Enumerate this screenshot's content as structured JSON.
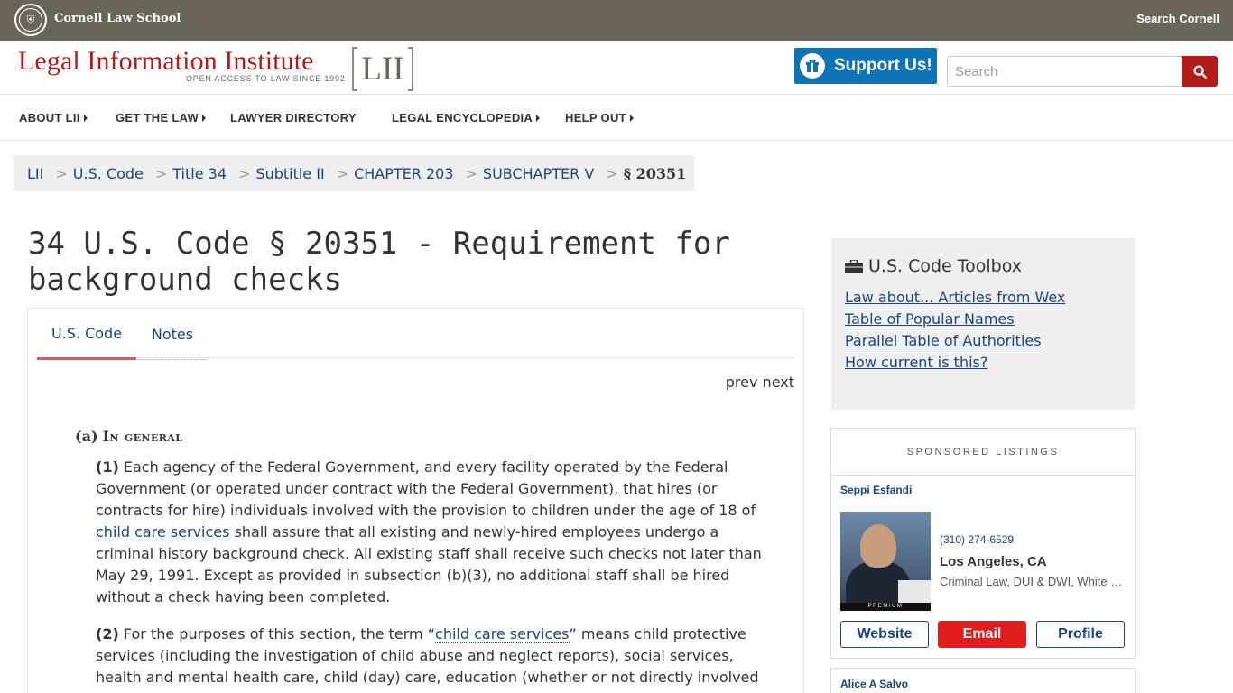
{
  "cornell": {
    "name": "Cornell Law School",
    "search_link": "Search Cornell"
  },
  "logo": {
    "title": "Legal Information Institute",
    "tagline": "OPEN ACCESS TO LAW SINCE 1992",
    "mark": "LII"
  },
  "header": {
    "support_label": "Support Us!",
    "search_placeholder": "Search"
  },
  "nav": {
    "items": [
      {
        "label": "ABOUT LII"
      },
      {
        "label": "GET THE LAW"
      },
      {
        "label": "LAWYER DIRECTORY"
      },
      {
        "label": "LEGAL ENCYCLOPEDIA"
      },
      {
        "label": "HELP OUT"
      }
    ]
  },
  "breadcrumb": {
    "items": [
      "LII",
      "U.S. Code",
      "Title 34",
      "Subtitle II",
      "CHAPTER 203",
      "SUBCHAPTER V"
    ],
    "separator": ">",
    "current": "§ 20351"
  },
  "page": {
    "title": "34 U.S. Code § 20351 - Requirement for background checks"
  },
  "tabs": {
    "code": "U.S. Code",
    "notes": "Notes"
  },
  "pager": {
    "prev": "prev",
    "next": "next"
  },
  "statute": {
    "section_a": {
      "label": "(a)",
      "heading": "In general"
    },
    "p1": {
      "num": "(1)",
      "text_before": " Each agency of the Federal Government, and every facility operated by the Federal Government (or operated under contract with the Federal Government), that hires (or contracts for hire) individuals involved with the provision to children under the age of 18 of ",
      "term": "child care services",
      "text_after": " shall assure that all existing and newly-hired employees undergo a criminal history background check. All existing staff shall receive such checks not later than May 29, 1991. Except as provided in subsection (b)(3), no additional staff shall be hired without a check having been completed."
    },
    "p2": {
      "num": "(2)",
      "text_before": " For the purposes of this section, the term “",
      "term": "child care services",
      "text_after": "” means child protective services (including the investigation of child abuse and neglect reports), social services, health and mental health care, child (day) care, education (whether or not directly involved"
    }
  },
  "toolbox": {
    "title": "U.S. Code Toolbox",
    "links": [
      "Law about... Articles from Wex",
      "Table of Popular Names",
      "Parallel Table of Authorities",
      "How current is this?"
    ]
  },
  "sponsored": {
    "heading": "SPONSORED LISTINGS",
    "listing1": {
      "name": "Seppi Esfandi",
      "badge": "PREMIUM",
      "phone": "(310) 274-6529",
      "location": "Los Angeles, CA",
      "practice": "Criminal Law, DUI & DWI, White Collar Crime",
      "website": "Website",
      "email": "Email",
      "profile": "Profile"
    },
    "listing2": {
      "name": "Alice A Salvo"
    }
  },
  "colors": {
    "cornell_bar": "#6b6459",
    "brand_red": "#b31b1b",
    "support_blue": "#0d74b8",
    "link_blue": "#1a4480",
    "email_red": "#e01c1c"
  }
}
